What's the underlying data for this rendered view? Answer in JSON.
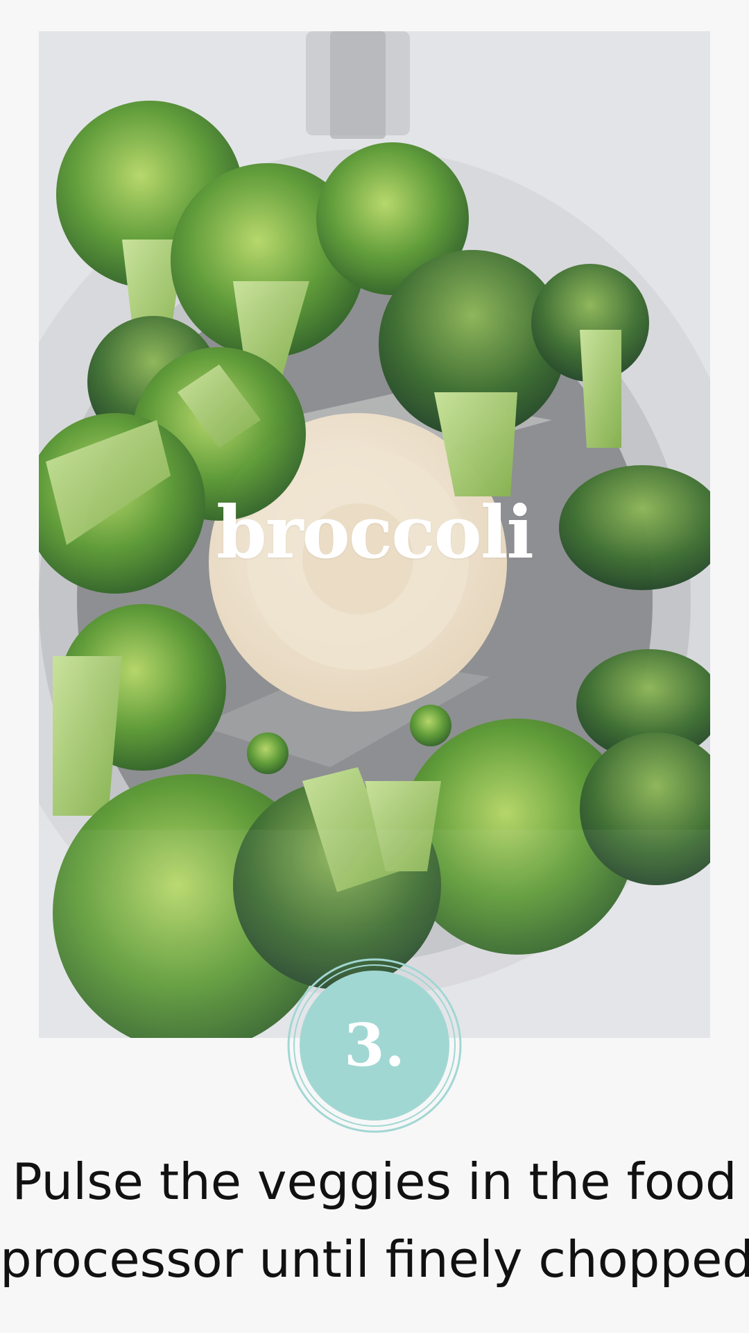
{
  "photo": {
    "overlay_word": "broccoli",
    "subject": "broccoli florets in a food processor"
  },
  "step": {
    "number": "3."
  },
  "caption": {
    "line1": "Pulse the veggies in the food",
    "line2": "processor until finely chopped."
  },
  "colors": {
    "page_background": "#f7f7f8",
    "badge_fill": "#a1d7d3",
    "badge_ring": "#a1d7d3",
    "caption_text": "#111111",
    "overlay_text": "#ffffff"
  }
}
